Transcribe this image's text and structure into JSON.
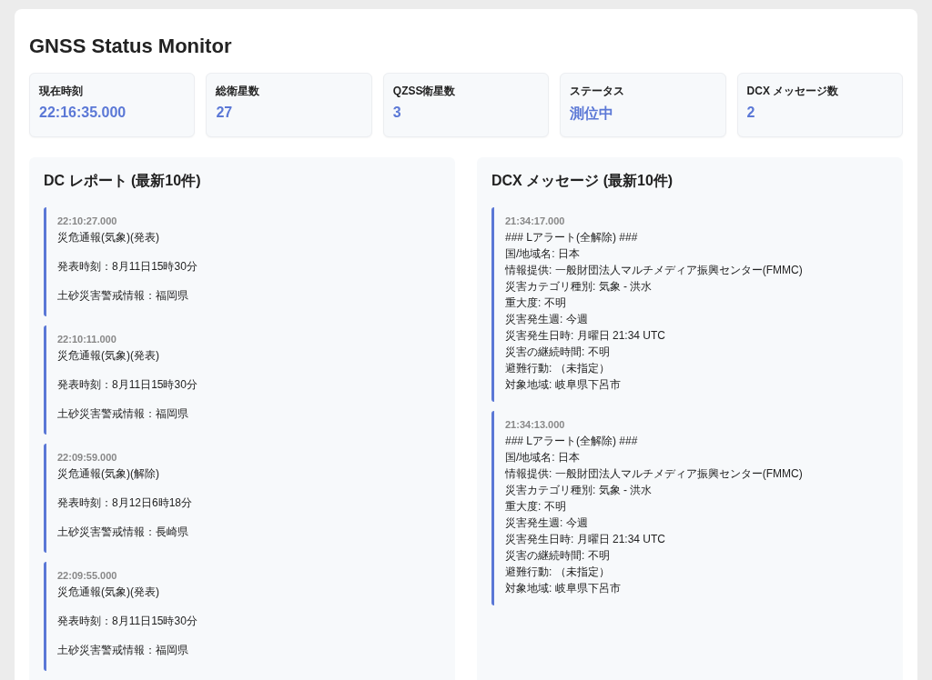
{
  "title": "GNSS Status Monitor",
  "stats": [
    {
      "label": "現在時刻",
      "value": "22:16:35.000"
    },
    {
      "label": "総衛星数",
      "value": "27"
    },
    {
      "label": "QZSS衛星数",
      "value": "3"
    },
    {
      "label": "ステータス",
      "value": "測位中"
    },
    {
      "label": "DCX メッセージ数",
      "value": "2"
    }
  ],
  "dc_panel": {
    "title": "DC レポート (最新10件)",
    "items": [
      {
        "time": "22:10:27.000",
        "lines": [
          "災危通報(気象)(発表)",
          "発表時刻：8月11日15時30分",
          "土砂災害警戒情報：福岡県"
        ]
      },
      {
        "time": "22:10:11.000",
        "lines": [
          "災危通報(気象)(発表)",
          "発表時刻：8月11日15時30分",
          "土砂災害警戒情報：福岡県"
        ]
      },
      {
        "time": "22:09:59.000",
        "lines": [
          "災危通報(気象)(解除)",
          "発表時刻：8月12日6時18分",
          "土砂災害警戒情報：長崎県"
        ]
      },
      {
        "time": "22:09:55.000",
        "lines": [
          "災危通報(気象)(発表)",
          "発表時刻：8月11日15時30分",
          "土砂災害警戒情報：福岡県"
        ]
      }
    ]
  },
  "dcx_panel": {
    "title": "DCX メッセージ (最新10件)",
    "items": [
      {
        "time": "21:34:17.000",
        "lines": [
          "### Lアラート(全解除) ###",
          "国/地域名: 日本",
          "情報提供: 一般財団法人マルチメディア振興センター(FMMC)",
          "災害カテゴリ種別: 気象 - 洪水",
          "重大度: 不明",
          "災害発生週: 今週",
          "災害発生日時: 月曜日 21:34 UTC",
          "災害の継続時間: 不明",
          "避難行動: （未指定）",
          "対象地域: 岐阜県下呂市"
        ]
      },
      {
        "time": "21:34:13.000",
        "lines": [
          "### Lアラート(全解除) ###",
          "国/地域名: 日本",
          "情報提供: 一般財団法人マルチメディア振興センター(FMMC)",
          "災害カテゴリ種別: 気象 - 洪水",
          "重大度: 不明",
          "災害発生週: 今週",
          "災害発生日時: 月曜日 21:34 UTC",
          "災害の継続時間: 不明",
          "避難行動: （未指定）",
          "対象地域: 岐阜県下呂市"
        ]
      }
    ]
  }
}
